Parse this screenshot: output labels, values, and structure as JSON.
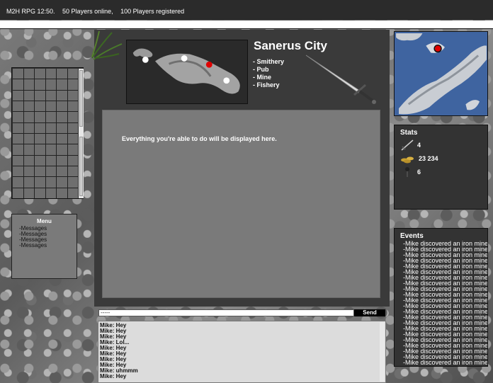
{
  "header": {
    "game_name": "M2H RPG 12:50.",
    "online": "50 Players online,",
    "registered": "100 Players registered"
  },
  "city": {
    "name": "Sanerus City",
    "locations": [
      "- Smithery",
      "- Pub",
      "- Mine",
      "- Fishery"
    ]
  },
  "main": {
    "message": "Everything you're able to do will be displayed here."
  },
  "menu": {
    "title": "Menu",
    "items": [
      "-Messages",
      "-Messages",
      "-Messages",
      "-Messages"
    ]
  },
  "stats": {
    "title": "Stats",
    "attack": "4",
    "gold": "23 234",
    "defense": "6",
    "icons": [
      "sword-icon",
      "gold-coins-icon",
      "shield-icon"
    ]
  },
  "events": {
    "title": "Events",
    "items": [
      "-Mike discovered an iron mine",
      "-Mike discovered an iron mine",
      "-Mike discovered an iron mine",
      "-Mike discovered an iron mine",
      "-Mike discovered an iron mine",
      "-Mike discovered an iron mine",
      "-Mike discovered an iron mine",
      "-Mike discovered an iron mine",
      "-Mike discovered an iron mine",
      "-Mike discovered an iron mine",
      "-Mike discovered an iron mine",
      "-Mike discovered an iron mine",
      "-Mike discovered an iron mine",
      "-Mike discovered an iron mine",
      "-Mike discovered an iron mine",
      "-Mike discovered an iron mine",
      "-Mike discovered an iron mine",
      "-Mike discovered an iron mine",
      "-Mike discovered an iron mine",
      "-Mike discovered an iron mine",
      "-Mike discovered an iron mine",
      "-Mike discovered an iron mine"
    ]
  },
  "chat": {
    "input_value": "-----",
    "send_label": "Send",
    "lines": [
      "Mike: Hey",
      "Mike: Hey",
      "Mike: Hey",
      "Mike: Lol...",
      "Mike: Hey",
      "Mike: Hey",
      "Mike: Hey",
      "Mike: Hey",
      "Mike: uhmmm",
      "Mike: Hey"
    ]
  },
  "colors": {
    "map_marker_current": "#e00000",
    "map_marker_other": "#ffffff"
  }
}
